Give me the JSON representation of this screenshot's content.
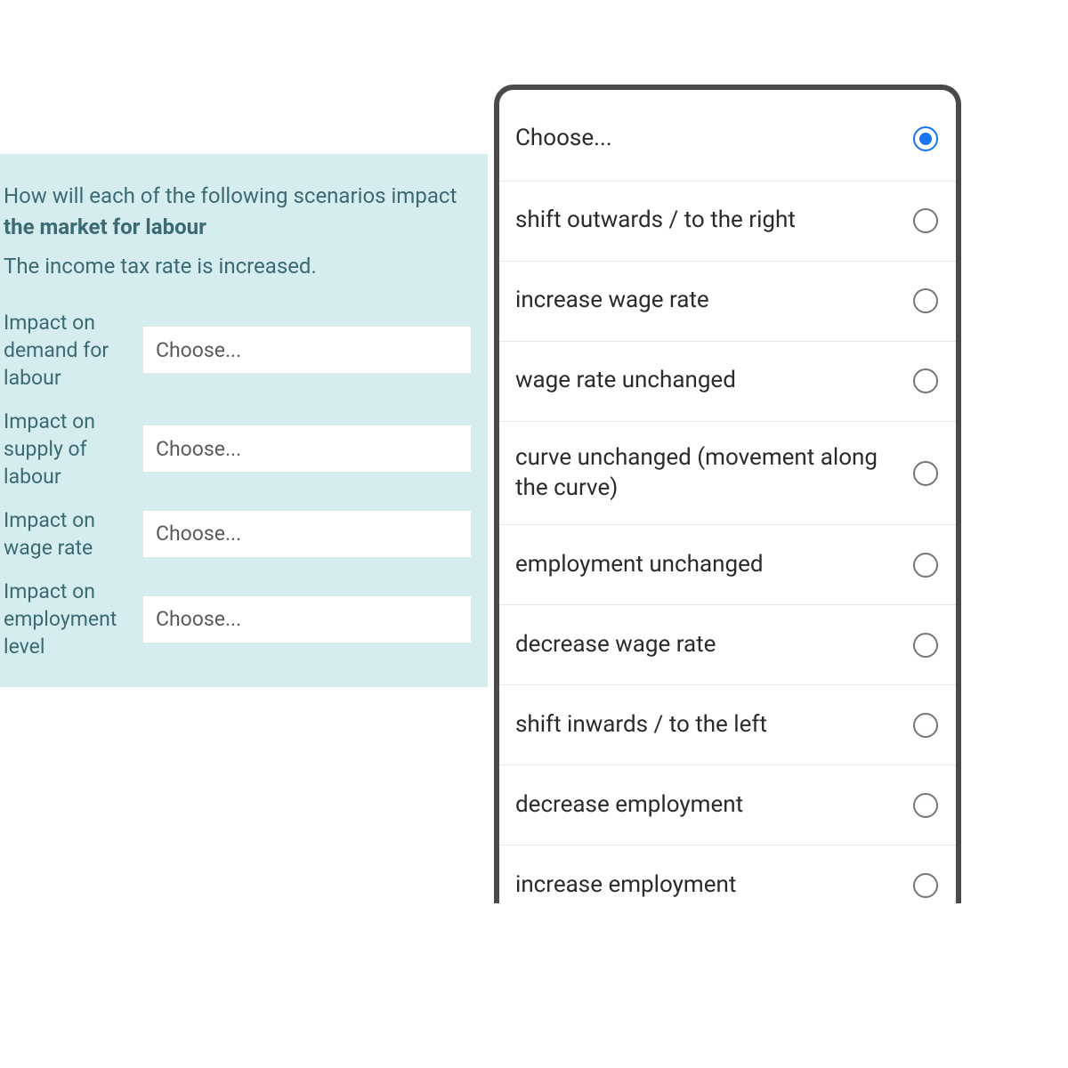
{
  "question": {
    "prefix": "How will each of the following scenarios impact ",
    "bold": "the market for labour",
    "scenario": "The income tax rate is increased."
  },
  "fields": [
    {
      "label": "Impact on demand for labour",
      "value": "Choose..."
    },
    {
      "label": "Impact on supply of labour",
      "value": "Choose..."
    },
    {
      "label": "Impact on wage rate",
      "value": "Choose..."
    },
    {
      "label": "Impact on employment level",
      "value": "Choose..."
    }
  ],
  "options": [
    {
      "label": "Choose...",
      "selected": true
    },
    {
      "label": "shift outwards / to the right",
      "selected": false
    },
    {
      "label": "increase wage rate",
      "selected": false
    },
    {
      "label": "wage rate unchanged",
      "selected": false
    },
    {
      "label": "curve unchanged (movement along the curve)",
      "selected": false
    },
    {
      "label": "employment unchanged",
      "selected": false
    },
    {
      "label": "decrease wage rate",
      "selected": false
    },
    {
      "label": "shift inwards / to the left",
      "selected": false
    },
    {
      "label": "decrease employment",
      "selected": false
    },
    {
      "label": "increase employment",
      "selected": false
    }
  ]
}
